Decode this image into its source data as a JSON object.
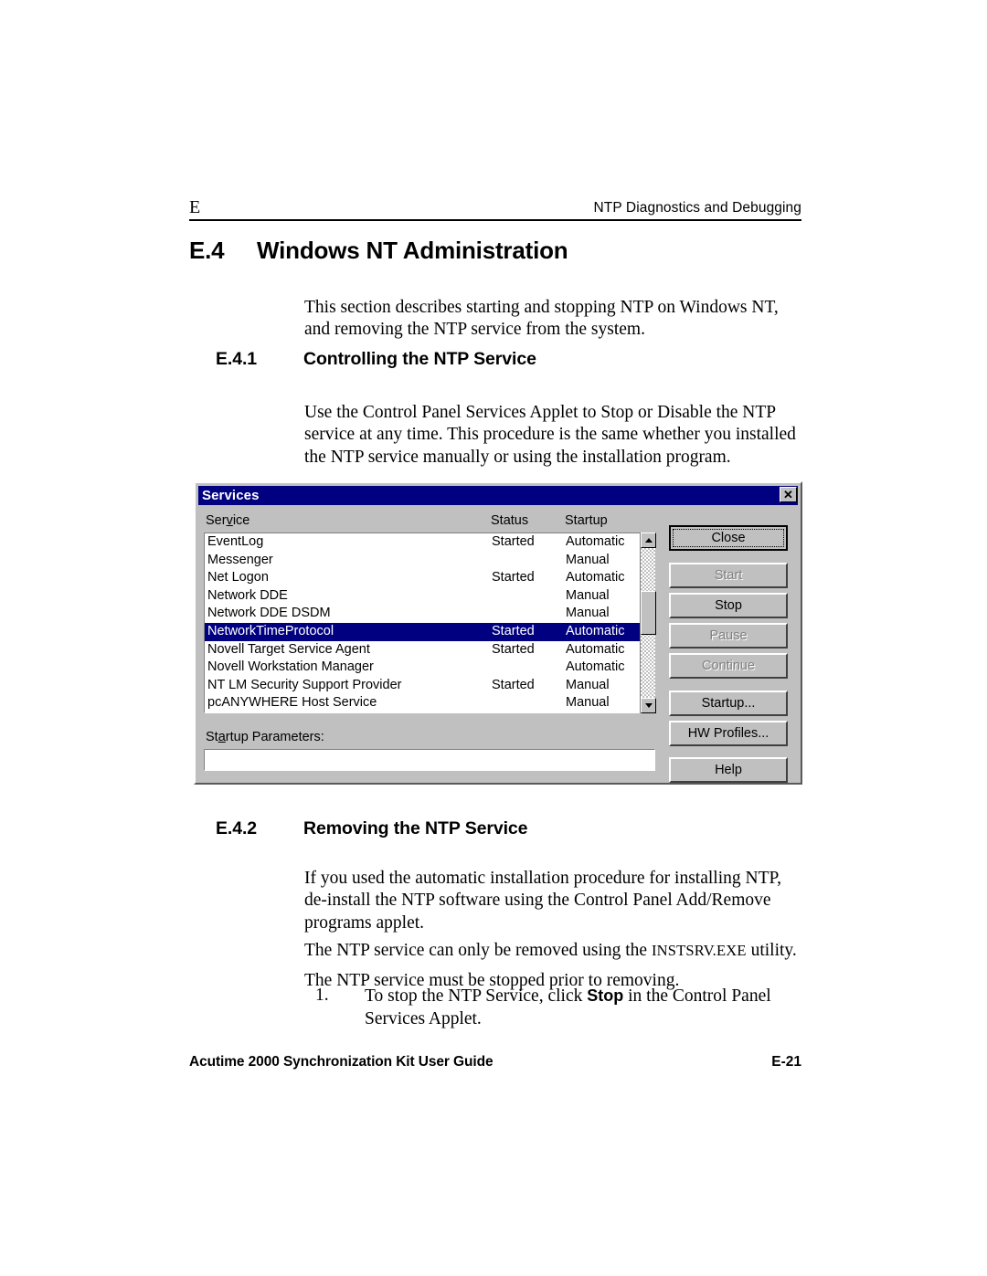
{
  "header": {
    "chapter_marker": "E",
    "running_title": "NTP Diagnostics and Debugging"
  },
  "section": {
    "number": "E.4",
    "title": "Windows NT Administration",
    "intro": "This section describes starting and stopping NTP on Windows NT, and removing the NTP service from the system."
  },
  "subsection_1": {
    "number": "E.4.1",
    "title": "Controlling the NTP Service",
    "paragraph": "Use the Control Panel Services Applet to Stop or Disable the NTP service at any time. This procedure is the same whether you installed the NTP service manually or using the installation program."
  },
  "subsection_2": {
    "number": "E.4.2",
    "title": "Removing the NTP Service",
    "paragraph_1": "If you used the automatic installation procedure for installing NTP, de-install the NTP software using the Control Panel Add/Remove programs applet.",
    "paragraph_2_before": "The NTP service can only be removed using the ",
    "paragraph_2_smallcaps": "INSTSRV.EXE",
    "paragraph_2_after": " utility.",
    "paragraph_3": "The NTP service must be stopped prior to removing.",
    "list": [
      {
        "marker": "1.",
        "text_before": "To stop the NTP Service, click ",
        "text_bold": "Stop",
        "text_after": " in the Control Panel Services Applet."
      }
    ]
  },
  "services_dialog": {
    "title": "Services",
    "close_icon_glyph": "✕",
    "columns": {
      "service": "Service",
      "service_accel_index": 3,
      "status": "Status",
      "startup": "Startup"
    },
    "rows": [
      {
        "name": "EventLog",
        "status": "Started",
        "startup": "Automatic",
        "selected": false
      },
      {
        "name": "Messenger",
        "status": "",
        "startup": "Manual",
        "selected": false
      },
      {
        "name": "Net Logon",
        "status": "Started",
        "startup": "Automatic",
        "selected": false
      },
      {
        "name": "Network DDE",
        "status": "",
        "startup": "Manual",
        "selected": false
      },
      {
        "name": "Network DDE DSDM",
        "status": "",
        "startup": "Manual",
        "selected": false
      },
      {
        "name": "NetworkTimeProtocol",
        "status": "Started",
        "startup": "Automatic",
        "selected": true
      },
      {
        "name": "Novell Target Service Agent",
        "status": "Started",
        "startup": "Automatic",
        "selected": false
      },
      {
        "name": "Novell Workstation Manager",
        "status": "",
        "startup": "Automatic",
        "selected": false
      },
      {
        "name": "NT LM Security Support Provider",
        "status": "Started",
        "startup": "Manual",
        "selected": false
      },
      {
        "name": "pcANYWHERE Host Service",
        "status": "",
        "startup": "Manual",
        "selected": false
      }
    ],
    "startup_parameters": {
      "label": "Startup Parameters:",
      "value": "",
      "placeholder": ""
    },
    "buttons": [
      {
        "label": "Close",
        "state": "default"
      },
      {
        "label": "Start",
        "state": "disabled"
      },
      {
        "label": "Stop",
        "state": "enabled"
      },
      {
        "label": "Pause",
        "state": "disabled"
      },
      {
        "label": "Continue",
        "state": "disabled"
      },
      {
        "label": "Startup...",
        "state": "enabled"
      },
      {
        "label": "HW Profiles...",
        "state": "enabled"
      },
      {
        "label": "Help",
        "state": "enabled"
      }
    ],
    "colors": {
      "titlebar": "#000080",
      "selection": "#000080",
      "face": "#c0c0c0"
    }
  },
  "footer": {
    "left": "Acutime 2000 Synchronization Kit User Guide",
    "right": "E-21"
  }
}
